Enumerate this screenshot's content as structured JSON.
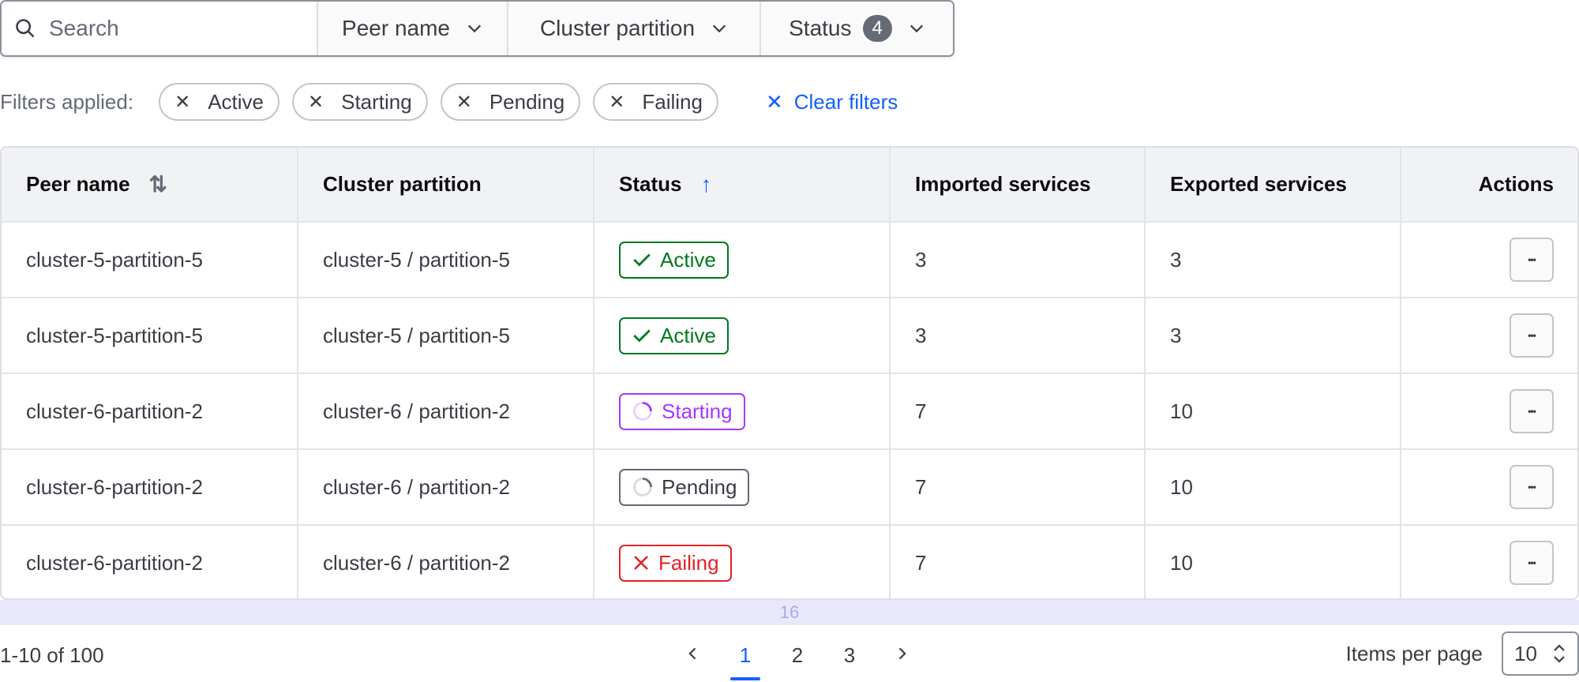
{
  "filters": {
    "search_placeholder": "Search",
    "search_value": "",
    "peer_name": "Peer name",
    "cluster_partition": "Cluster partition",
    "status": "Status",
    "status_count": "4"
  },
  "applied": {
    "label": "Filters applied:",
    "chips": [
      "Active",
      "Starting",
      "Pending",
      "Failing"
    ],
    "clear": "Clear filters"
  },
  "table": {
    "headers": [
      "Peer name",
      "Cluster partition",
      "Status",
      "Imported services",
      "Exported services",
      "Actions"
    ],
    "sort": {
      "peer_name": "unsorted",
      "status": "ascending"
    },
    "rows": [
      {
        "peer": "cluster-5-partition-5",
        "partition": "cluster-5 / partition-5",
        "status": "Active",
        "imported": "3",
        "exported": "3"
      },
      {
        "peer": "cluster-5-partition-5",
        "partition": "cluster-5 / partition-5",
        "status": "Active",
        "imported": "3",
        "exported": "3"
      },
      {
        "peer": "cluster-6-partition-2",
        "partition": "cluster-6 / partition-2",
        "status": "Starting",
        "imported": "7",
        "exported": "10"
      },
      {
        "peer": "cluster-6-partition-2",
        "partition": "cluster-6 / partition-2",
        "status": "Pending",
        "imported": "7",
        "exported": "10"
      },
      {
        "peer": "cluster-6-partition-2",
        "partition": "cluster-6 / partition-2",
        "status": "Failing",
        "imported": "7",
        "exported": "10"
      }
    ],
    "more_label": "•••"
  },
  "status_styles": {
    "Active": {
      "color": "#00781e",
      "icon": "check-icon"
    },
    "Starting": {
      "color": "#a737ff",
      "icon": "loading-icon"
    },
    "Pending": {
      "color": "#656a76",
      "icon": "loading-icon"
    },
    "Failing": {
      "color": "#e52228",
      "icon": "x-icon"
    }
  },
  "band_label": "16",
  "pagination": {
    "range": "1-10 of 100",
    "pages": [
      "1",
      "2",
      "3"
    ],
    "current": "1",
    "items_per_page_label": "Items per page",
    "items_per_page": "10"
  }
}
